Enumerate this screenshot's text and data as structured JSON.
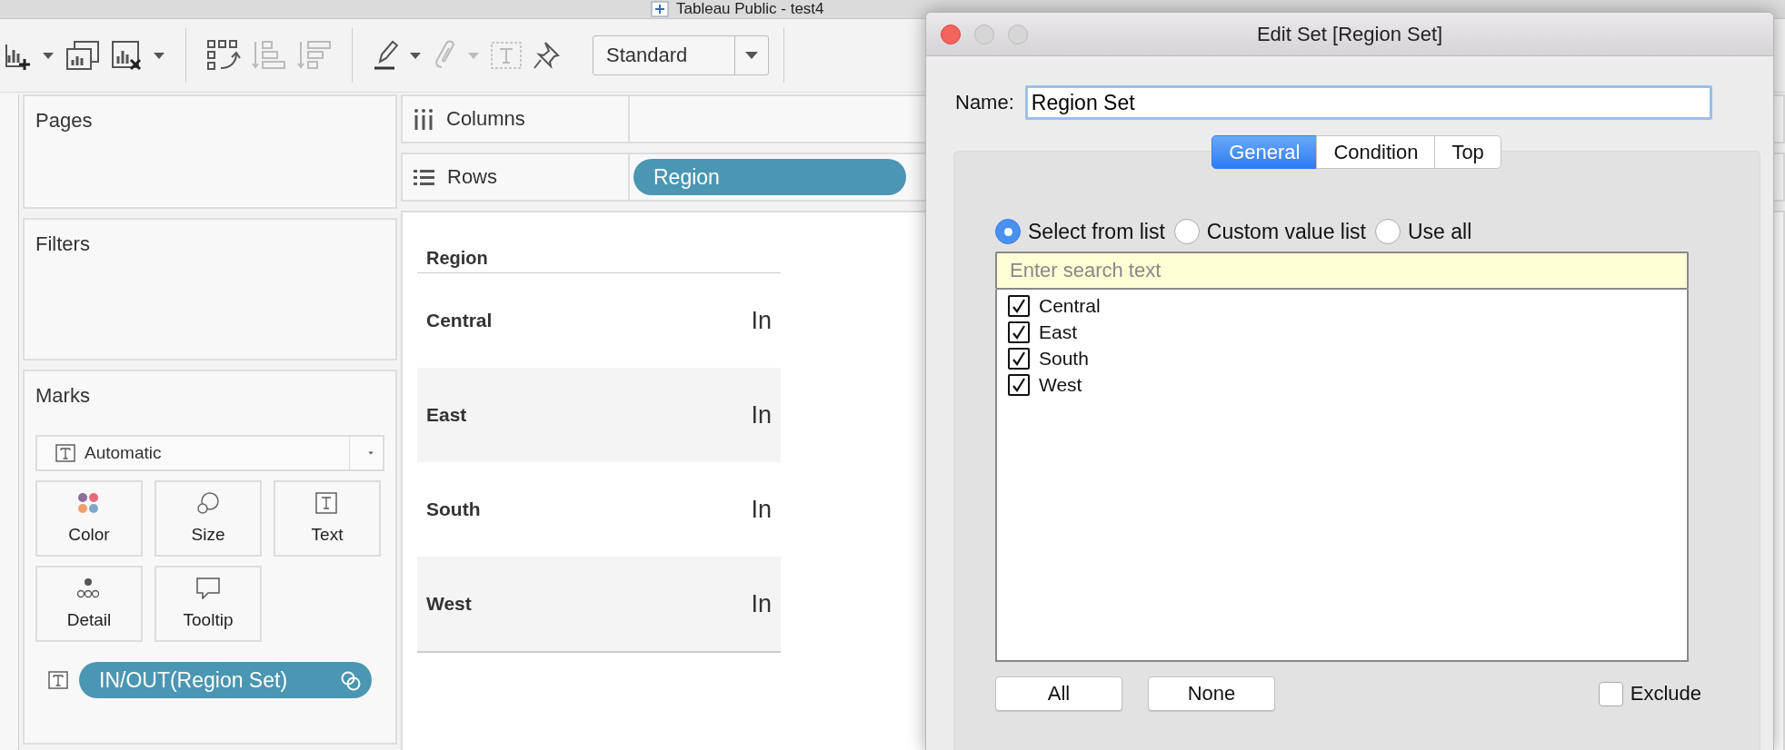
{
  "window": {
    "title": "Tableau Public - test4"
  },
  "toolbar": {
    "view_dropdown": "Standard"
  },
  "cards": [
    {
      "kind": "pages",
      "title": "Pages"
    },
    {
      "kind": "filters",
      "title": "Filters"
    },
    {
      "kind": "marks",
      "title": "Marks",
      "mark_type": "Automatic",
      "pill": "IN/OUT(Region Set)",
      "buttons": [
        {
          "kind": "color",
          "label": "Color"
        },
        {
          "kind": "size",
          "label": "Size"
        },
        {
          "kind": "text",
          "label": "Text"
        },
        {
          "kind": "detail",
          "label": "Detail"
        },
        {
          "kind": "tooltip",
          "label": "Tooltip"
        }
      ]
    }
  ],
  "shelves": [
    {
      "kind": "columns",
      "label": "Columns"
    },
    {
      "kind": "rows",
      "label": "Rows",
      "pill": "Region"
    }
  ],
  "table": {
    "columns": [
      "Region"
    ],
    "rows": [
      {
        "region": "Central",
        "value": "In"
      },
      {
        "region": "East",
        "value": "In"
      },
      {
        "region": "South",
        "value": "In"
      },
      {
        "region": "West",
        "value": "In"
      }
    ]
  },
  "dialog": {
    "title": "Edit Set [Region Set]",
    "name_label": "Name:",
    "name_value": "Region Set",
    "tabs": [
      {
        "label": "General",
        "selected": true
      },
      {
        "label": "Condition",
        "selected": false
      },
      {
        "label": "Top",
        "selected": false
      }
    ],
    "modes": [
      {
        "label": "Select from list",
        "selected": true
      },
      {
        "label": "Custom value list",
        "selected": false
      },
      {
        "label": "Use all",
        "selected": false
      }
    ],
    "search": {
      "placeholder": "Enter search text"
    },
    "items": [
      {
        "label": "Central",
        "checked": true
      },
      {
        "label": "East",
        "checked": true
      },
      {
        "label": "South",
        "checked": true
      },
      {
        "label": "West",
        "checked": true
      }
    ],
    "buttons": [
      "All",
      "None"
    ],
    "exclude": {
      "label": "Exclude",
      "checked": false
    }
  }
}
